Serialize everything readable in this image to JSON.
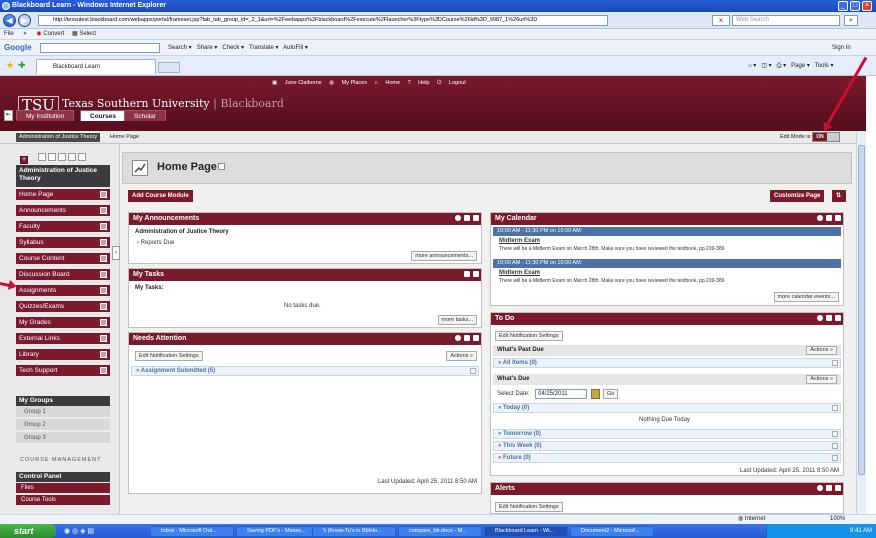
{
  "window": {
    "title": "Blackboard Learn - Windows Internet Explorer"
  },
  "browser": {
    "url": "http://texsutest.blackboard.com/webapps/portal/frameset.jsp?tab_tab_group_id=_2_1&url=%2Fwebapps%2Fblackboard%2Fexecute%2Flauncher%3Ftype%3DCourse%26id%3D_9987_1%26url%3D",
    "search_placeholder": "Web Search",
    "menu": [
      "File",
      "»",
      "Convert",
      "Select"
    ],
    "google": {
      "label": "Google",
      "items": [
        "Search",
        "Share",
        "Check",
        "Translate",
        "AutoFill"
      ],
      "signin": "Sign In"
    },
    "fav_tab": "Blackboard Learn",
    "toolbar_right": [
      "Page",
      "Tools"
    ],
    "status": {
      "zone": "Internet",
      "zoom": "100%"
    }
  },
  "header": {
    "user": "June Claiborne",
    "links": [
      "My Places",
      "Home",
      "Help",
      "Logout"
    ],
    "logo": "TSU",
    "school": "Texas Southern University",
    "separator": "|",
    "product": "Blackboard"
  },
  "tabs": [
    "My Institution",
    "Courses",
    "Scholar"
  ],
  "breadcrumb": {
    "course": "Administration of Justice Theory",
    "page": "Home Page"
  },
  "edit_mode": {
    "label": "Edit Mode is:",
    "value": "ON"
  },
  "course_menu": {
    "title": "Administration of Justice Theory",
    "items": [
      "Home Page",
      "Announcements",
      "Faculty",
      "Syllabus",
      "Course Content",
      "Discussion Board",
      "Assignments",
      "Quizzes/Exams",
      "My Grades",
      "External Links",
      "Library",
      "Tech Support"
    ]
  },
  "my_groups": {
    "title": "My Groups",
    "items": [
      "Group 1",
      "Group 2",
      "Group 3"
    ]
  },
  "course_management": {
    "label": "COURSE MANAGEMENT",
    "control_panel": "Control Panel",
    "items": [
      "Files",
      "Course Tools"
    ]
  },
  "page": {
    "title": "Home Page",
    "add_module": "Add Course Module",
    "customize": "Customize Page"
  },
  "announcements": {
    "title": "My Announcements",
    "course": "Administration of Justice Theory",
    "item": "Reports Due",
    "more": "more announcements..."
  },
  "tasks": {
    "title": "My Tasks",
    "sub": "My Tasks:",
    "empty": "No tasks due.",
    "more": "more tasks..."
  },
  "needs_attention": {
    "title": "Needs Attention",
    "settings": "Edit Notification Settings",
    "actions": "Actions",
    "row": "Assignment Submitted (5)",
    "updated": "Last Updated: April 25, 2011 8:50 AM"
  },
  "calendar": {
    "title": "My Calendar",
    "events": [
      {
        "time": "10:00 AM - 11:30 PM on 10:00 AM:",
        "name": "Midterm Exam",
        "desc": "There will be a Midterm Exam on March 28th. Make sure you have reviewed the textbook, pp.239-389"
      },
      {
        "time": "10:00 AM - 11:30 PM on 10:00 AM:",
        "name": "Midterm Exam",
        "desc": "There will be a Midterm Exam on March 28th. Make sure you have reviewed the textbook, pp.239-389"
      }
    ],
    "more": "more calendar events..."
  },
  "todo": {
    "title": "To Do",
    "settings": "Edit Notification Settings",
    "past_due": "What's Past Due",
    "actions": "Actions",
    "all_items": "All Items (0)",
    "whats_due": "What's Due",
    "select_date": "Select Date:",
    "date": "04/25/2011",
    "go": "Go",
    "today": "Today (0)",
    "nothing": "Nothing Due Today",
    "tomorrow": "Tomorrow (0)",
    "this_week": "This Week (0)",
    "future": "Future (0)",
    "updated": "Last Updated: April 25, 2011 8:50 AM"
  },
  "alerts": {
    "title": "Alerts",
    "settings": "Edit Notification Settings"
  },
  "taskbar": {
    "start": "start",
    "items": [
      "Inbox - Microsoft Out...",
      "Saving PDF's - Messe...",
      "\\\\ (Know-To's in Bb\\Ho...",
      "compare_bb.docx - M...",
      "Blackboard Learn - Wi...",
      "Document2 - Microsof..."
    ],
    "clock": "9:41 AM"
  },
  "colors": {
    "maroon": "#7a1a2c",
    "annotation": "#c8102e"
  }
}
